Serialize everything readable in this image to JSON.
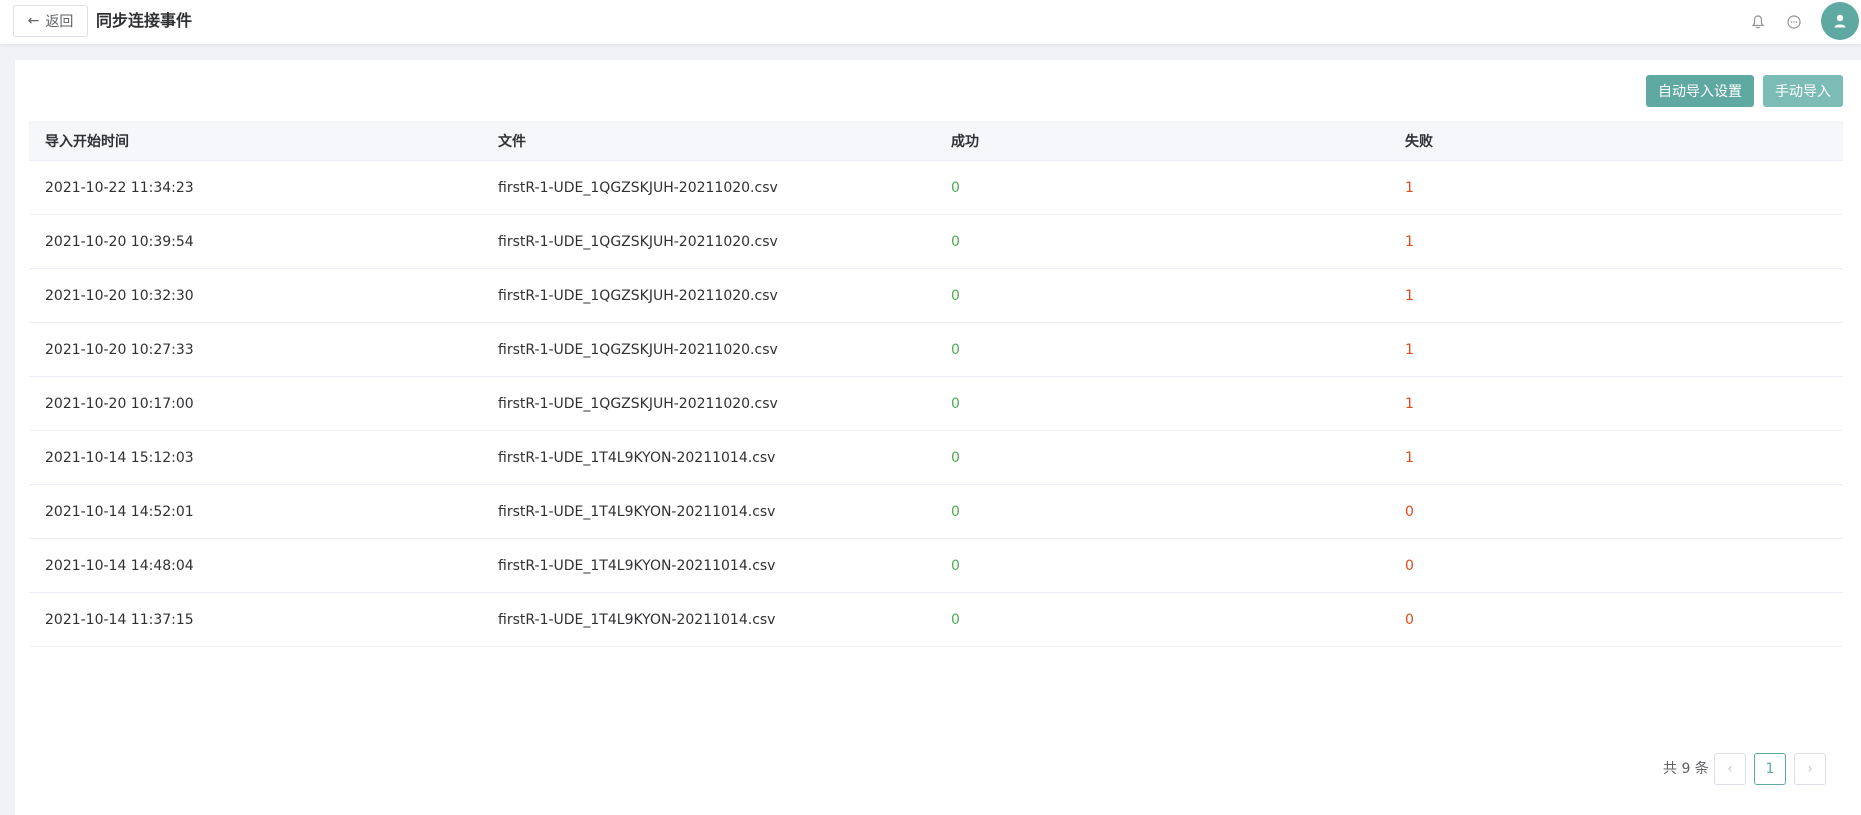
{
  "header": {
    "back_label": "返回",
    "title": "同步连接事件"
  },
  "toolbar": {
    "auto_import_label": "自动导入设置",
    "manual_import_label": "手动导入"
  },
  "table": {
    "columns": [
      "导入开始时间",
      "文件",
      "成功",
      "失败"
    ],
    "rows": [
      {
        "time": "2021-10-22 11:34:23",
        "file": "firstR-1-UDE_1QGZSKJUH-20211020.csv",
        "success": "0",
        "fail": "1"
      },
      {
        "time": "2021-10-20 10:39:54",
        "file": "firstR-1-UDE_1QGZSKJUH-20211020.csv",
        "success": "0",
        "fail": "1"
      },
      {
        "time": "2021-10-20 10:32:30",
        "file": "firstR-1-UDE_1QGZSKJUH-20211020.csv",
        "success": "0",
        "fail": "1"
      },
      {
        "time": "2021-10-20 10:27:33",
        "file": "firstR-1-UDE_1QGZSKJUH-20211020.csv",
        "success": "0",
        "fail": "1"
      },
      {
        "time": "2021-10-20 10:17:00",
        "file": "firstR-1-UDE_1QGZSKJUH-20211020.csv",
        "success": "0",
        "fail": "1"
      },
      {
        "time": "2021-10-14 15:12:03",
        "file": "firstR-1-UDE_1T4L9KYON-20211014.csv",
        "success": "0",
        "fail": "1"
      },
      {
        "time": "2021-10-14 14:52:01",
        "file": "firstR-1-UDE_1T4L9KYON-20211014.csv",
        "success": "0",
        "fail": "0"
      },
      {
        "time": "2021-10-14 14:48:04",
        "file": "firstR-1-UDE_1T4L9KYON-20211014.csv",
        "success": "0",
        "fail": "0"
      },
      {
        "time": "2021-10-14 11:37:15",
        "file": "firstR-1-UDE_1T4L9KYON-20211014.csv",
        "success": "0",
        "fail": "0"
      }
    ]
  },
  "pagination": {
    "total_label": "共 9 条",
    "current_page": "1",
    "prev_glyph": "‹",
    "next_glyph": "›"
  },
  "icons": {
    "back": "arrow-left-icon",
    "bell": "bell-icon",
    "chat": "chat-icon",
    "avatar": "user-icon"
  },
  "colors": {
    "accent": "#5fa9a2",
    "success": "#4caf50",
    "fail": "#e24a1e"
  }
}
